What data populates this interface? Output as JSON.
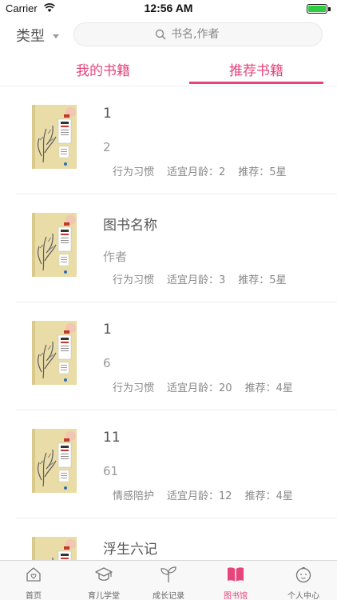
{
  "status_bar": {
    "carrier": "Carrier",
    "time": "12:56 AM"
  },
  "header": {
    "type_label": "类型",
    "search_placeholder": "书名,作者"
  },
  "tabs": [
    {
      "label": "我的书籍",
      "active": false
    },
    {
      "label": "推荐书籍",
      "active": true
    }
  ],
  "books": [
    {
      "title": "1",
      "author": "2",
      "category": "行为习惯",
      "age": "适宜月龄：2",
      "rating": "推荐：5星"
    },
    {
      "title": "图书名称",
      "author": "作者",
      "category": "行为习惯",
      "age": "适宜月龄：3",
      "rating": "推荐：5星"
    },
    {
      "title": "1",
      "author": "6",
      "category": "行为习惯",
      "age": "适宜月龄：20",
      "rating": "推荐：4星"
    },
    {
      "title": "11",
      "author": "61",
      "category": "情感陪护",
      "age": "适宜月龄：12",
      "rating": "推荐：4星"
    },
    {
      "title": "浮生六记",
      "author": "",
      "category": "",
      "age": "",
      "rating": ""
    }
  ],
  "tabbar": [
    {
      "label": "首页",
      "icon": "home-heart-icon",
      "active": false
    },
    {
      "label": "育儿学堂",
      "icon": "graduation-cap-icon",
      "active": false
    },
    {
      "label": "成长记录",
      "icon": "sprout-icon",
      "active": false
    },
    {
      "label": "图书馆",
      "icon": "open-book-icon",
      "active": true
    },
    {
      "label": "个人中心",
      "icon": "baby-face-icon",
      "active": false
    }
  ],
  "colors": {
    "accent": "#e5457a",
    "battery": "#2ecc40"
  }
}
